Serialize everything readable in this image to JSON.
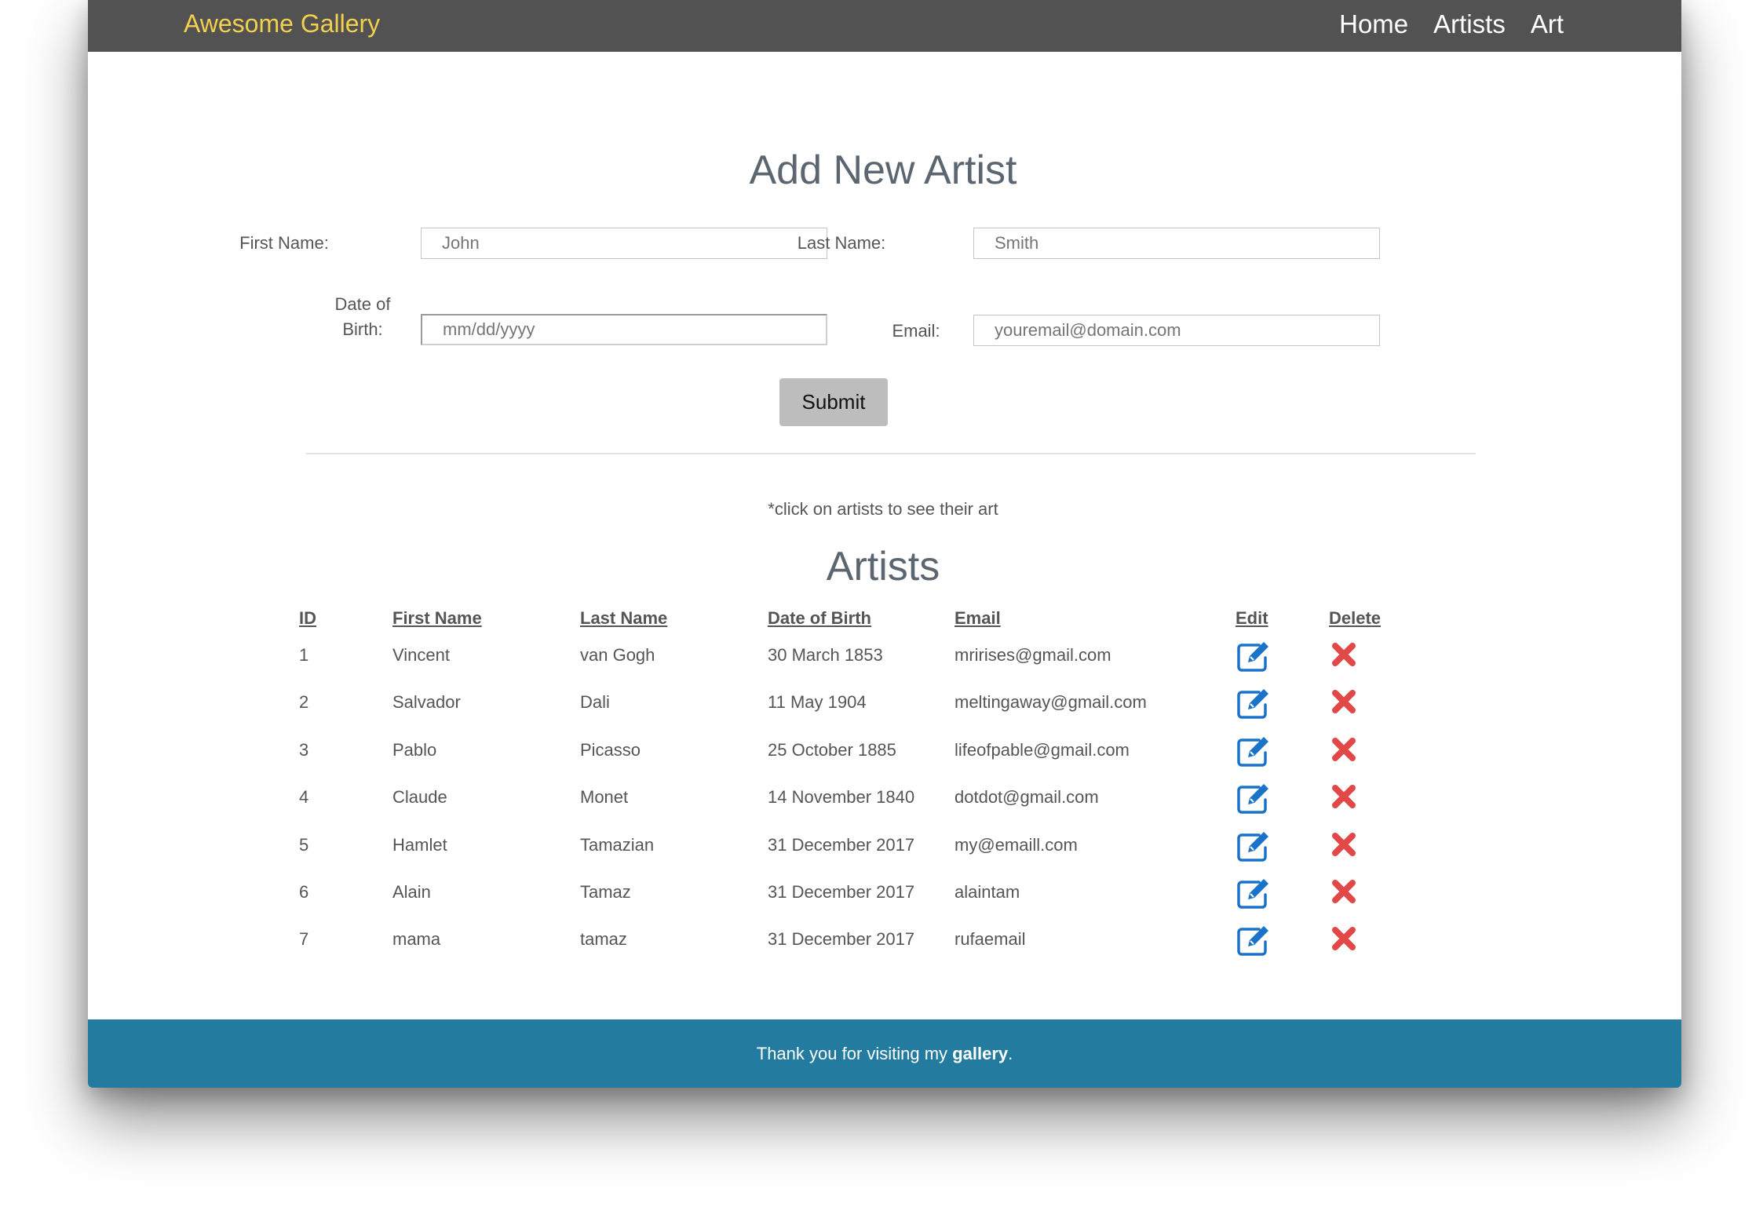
{
  "nav": {
    "brand": "Awesome Gallery",
    "links": [
      "Home",
      "Artists",
      "Art"
    ]
  },
  "form": {
    "title": "Add New Artist",
    "first_name_label": "First Name:",
    "first_name_placeholder": "John",
    "last_name_label": "Last Name:",
    "last_name_placeholder": "Smith",
    "dob_label": "Date of Birth:",
    "dob_placeholder": "mm/dd/yyyy",
    "email_label": "Email:",
    "email_placeholder": "youremail@domain.com",
    "submit_label": "Submit"
  },
  "hint": "*click on artists to see their art",
  "artists": {
    "title": "Artists",
    "columns": [
      "ID",
      "First Name",
      "Last Name",
      "Date of Birth",
      "Email",
      "Edit",
      "Delete"
    ],
    "rows": [
      {
        "id": "1",
        "first": "Vincent",
        "last": "van Gogh",
        "dob": "30 March 1853",
        "email": "mririses@gmail.com"
      },
      {
        "id": "2",
        "first": "Salvador",
        "last": "Dali",
        "dob": "11 May 1904",
        "email": "meltingaway@gmail.com"
      },
      {
        "id": "3",
        "first": "Pablo",
        "last": "Picasso",
        "dob": "25 October 1885",
        "email": "lifeofpable@gmail.com"
      },
      {
        "id": "4",
        "first": "Claude",
        "last": "Monet",
        "dob": "14 November 1840",
        "email": "dotdot@gmail.com"
      },
      {
        "id": "5",
        "first": "Hamlet",
        "last": "Tamazian",
        "dob": "31 December 2017",
        "email": "my@emaill.com"
      },
      {
        "id": "6",
        "first": "Alain",
        "last": "Tamaz",
        "dob": "31 December 2017",
        "email": "alaintam"
      },
      {
        "id": "7",
        "first": "mama",
        "last": "tamaz",
        "dob": "31 December 2017",
        "email": "rufaemail"
      }
    ],
    "row_icons": {
      "edit": "edit-pencil-icon",
      "delete": "delete-x-icon"
    }
  },
  "footer": {
    "text_before": "Thank you for visiting my ",
    "text_bold": "gallery",
    "text_after": "."
  },
  "colors": {
    "nav_bg": "#525252",
    "brand": "#f3d04d",
    "footer_bg": "#247ba0",
    "edit_icon": "#1a73c9",
    "delete_icon": "#e34848"
  }
}
